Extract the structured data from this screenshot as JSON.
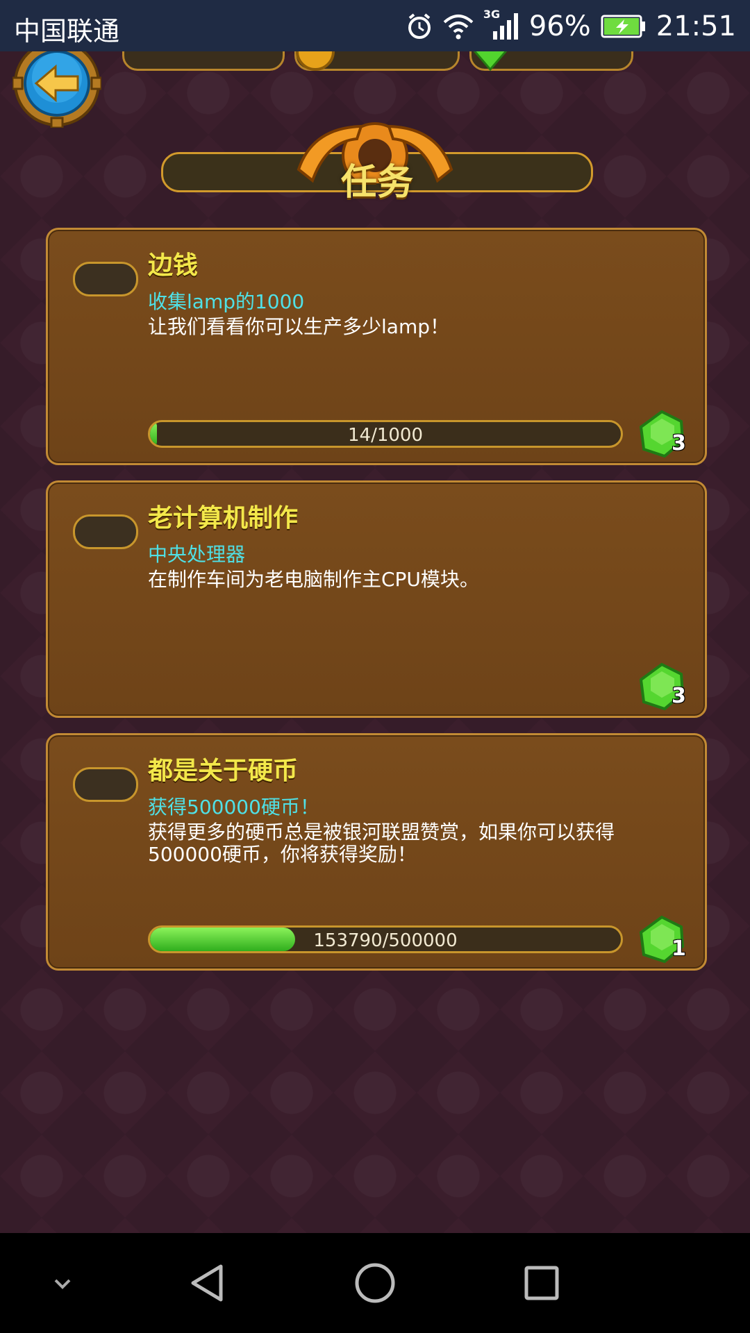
{
  "status_bar": {
    "carrier": "中国联通",
    "network": "3G",
    "battery": "96%",
    "time": "21:51"
  },
  "screen": {
    "title": "任务"
  },
  "quests": [
    {
      "title": "边钱",
      "subtitle": "收集lamp的1000",
      "description": "让我们看看你可以生产多少lamp！",
      "progress_text": "14/1000",
      "progress_fraction": 0.014,
      "reward_count": "3"
    },
    {
      "title": "老计算机制作",
      "subtitle": "中央处理器",
      "description": "在制作车间为老电脑制作主CPU模块。",
      "progress_text": "",
      "progress_fraction": null,
      "reward_count": "3"
    },
    {
      "title": "都是关于硬币",
      "subtitle": "获得500000硬币！",
      "description": "获得更多的硬币总是被银河联盟赞赏，如果你可以获得\n500000硬币，你将获得奖励！",
      "progress_text": "153790/500000",
      "progress_fraction": 0.3076,
      "reward_count": "1"
    }
  ],
  "icons": {
    "back": "back-arrow-icon",
    "gem": "green-gem-icon",
    "alarm": "alarm-icon",
    "wifi": "wifi-icon",
    "signal": "signal-icon",
    "battery": "battery-charging-icon",
    "nav_down": "chevron-down-icon",
    "nav_back": "back-triangle-icon",
    "nav_home": "home-circle-icon",
    "nav_recent": "recent-square-icon"
  },
  "colors": {
    "card": "#754819",
    "card_border": "#c28a34",
    "quest_title": "#f3e84a",
    "quest_subtitle": "#4fe0e6",
    "progress_fill": "#4cd22e",
    "background": "#3b1e2c"
  }
}
